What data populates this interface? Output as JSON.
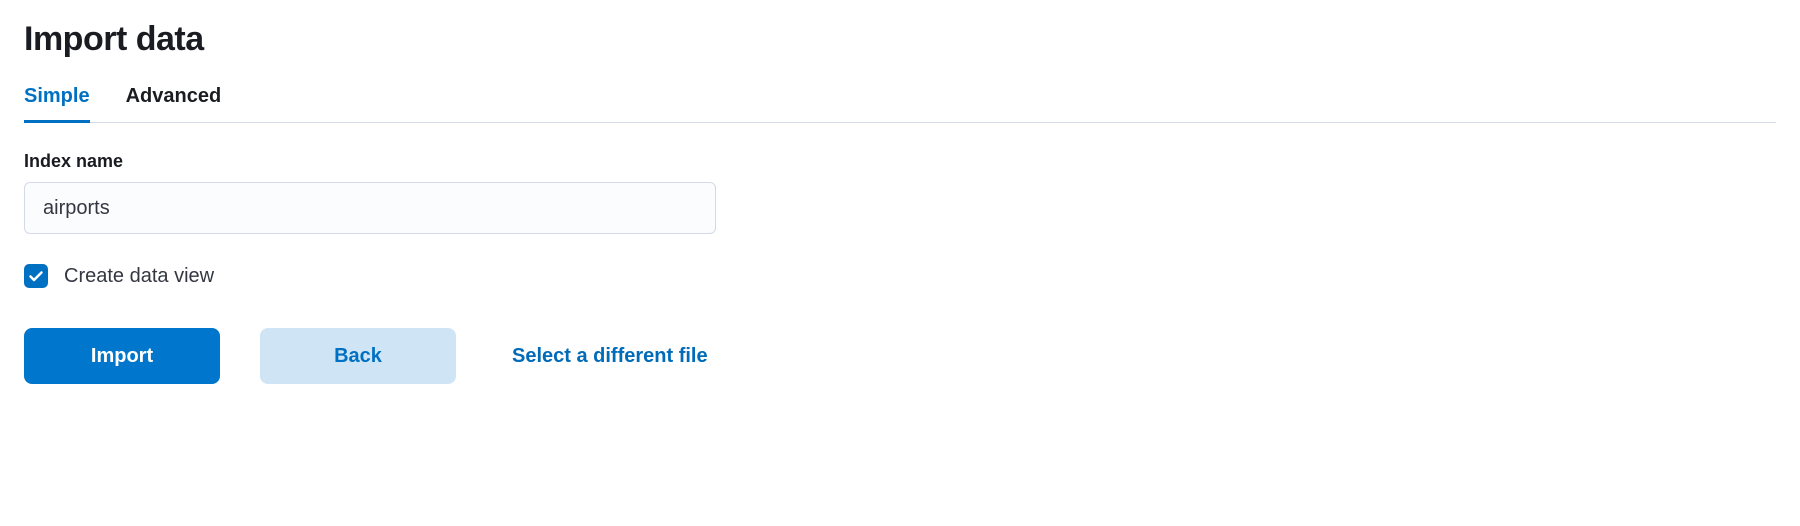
{
  "header": {
    "title": "Import data"
  },
  "tabs": {
    "simple": "Simple",
    "advanced": "Advanced",
    "selected": "simple"
  },
  "form": {
    "index_name_label": "Index name",
    "index_name_value": "airports",
    "create_data_view_label": "Create data view",
    "create_data_view_checked": true
  },
  "actions": {
    "import_label": "Import",
    "back_label": "Back",
    "select_different_file_label": "Select a different file"
  },
  "colors": {
    "primary": "#0077cc",
    "primary_text": "#0071c2",
    "secondary_bg": "#cfe4f5",
    "border": "#d3dae6"
  }
}
